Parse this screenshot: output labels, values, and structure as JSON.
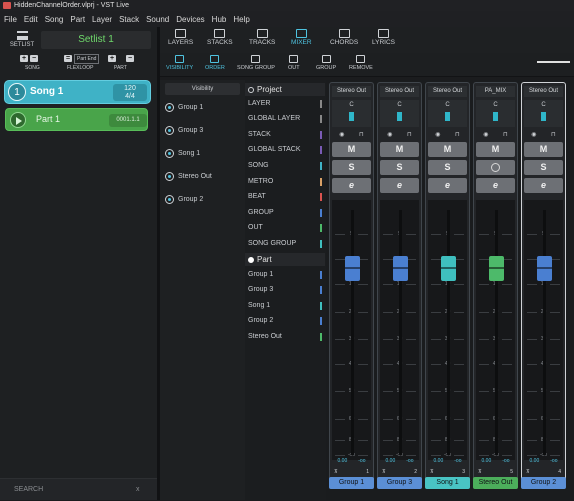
{
  "titlebar": {
    "title": "HiddenChannelOrder.vlprj - VST Live"
  },
  "menu": [
    "File",
    "Edit",
    "Song",
    "Part",
    "Layer",
    "Stack",
    "Sound",
    "Devices",
    "Hub",
    "Help"
  ],
  "setlist": {
    "button_label": "SETLIST",
    "name": "Setlist 1"
  },
  "controls": {
    "song_label": "SONG",
    "flexloop_label": "FLEXLOOP",
    "part_label": "PART",
    "part_end_label": "Part End"
  },
  "song": {
    "number": "1",
    "name": "Song 1",
    "tempo": "120",
    "signature": "4/4"
  },
  "part": {
    "name": "Part  1",
    "position": "0001.1.1"
  },
  "search": {
    "placeholder": "SEARCH",
    "clear": "x"
  },
  "topnav": [
    {
      "label": "LAYERS"
    },
    {
      "label": "STACKS"
    },
    {
      "label": "TRACKS"
    },
    {
      "label": "MIXER"
    },
    {
      "label": "CHORDS"
    },
    {
      "label": "LYRICS"
    }
  ],
  "subnav": [
    {
      "label": "VISIBILITY"
    },
    {
      "label": "ORDER"
    },
    {
      "label": "SONG GROUP"
    },
    {
      "label": "OUT"
    },
    {
      "label": "GROUP"
    },
    {
      "label": "REMOVE"
    }
  ],
  "visibility": {
    "header": "Visibility",
    "items": [
      "Group 1",
      "Group 3",
      "Song 1",
      "Stereo Out",
      "Group 2"
    ]
  },
  "list": {
    "project_header": "Project",
    "project_items": [
      "LAYER",
      "GLOBAL LAYER",
      "STACK",
      "GLOBAL STACK",
      "SONG",
      "METRO",
      "BEAT",
      "GROUP",
      "OUT",
      "SONG GROUP"
    ],
    "part_header": "Part",
    "part_items": [
      "Group 1",
      "Group 3",
      "Song 1",
      "Group 2",
      "Stereo Out"
    ]
  },
  "colors": {
    "accent": "#4fc3e0",
    "song": "#3fb2c6",
    "part": "#49a44a",
    "project_item_bar": "#4a6fa5"
  },
  "strips": [
    {
      "out": "Stereo Out",
      "name": "Group 1",
      "num": "1",
      "color": "#4a7fd1",
      "name_bg": "#5b8fd6",
      "meter": "#2fb6c9",
      "mute": "M",
      "solo": "S",
      "edit": "e",
      "left_val": "0.00",
      "right_val": "-oo"
    },
    {
      "out": "Stereo Out",
      "name": "Group 3",
      "num": "2",
      "color": "#4a7fd1",
      "name_bg": "#5b8fd6",
      "meter": "#2fb6c9",
      "mute": "M",
      "solo": "S",
      "edit": "e",
      "left_val": "0.00",
      "right_val": "-oo"
    },
    {
      "out": "Stereo Out",
      "name": "Song 1",
      "num": "3",
      "color": "#3fbfbf",
      "name_bg": "#49c4c4",
      "meter": "#2fb6c9",
      "mute": "M",
      "solo": "S",
      "edit": "e",
      "left_val": "0.00",
      "right_val": "-oo"
    },
    {
      "out": "PA_MIX",
      "name": "Stereo Out",
      "num": "5",
      "color": "#4dba6a",
      "name_bg": "#4cae5b",
      "meter": "#2fb6c9",
      "mute": "M",
      "solo": "",
      "edit": "e",
      "left_val": "0.00",
      "right_val": "-oo"
    },
    {
      "out": "Stereo Out",
      "name": "Group 2",
      "num": "4",
      "color": "#4a7fd1",
      "name_bg": "#5b8fd6",
      "meter": "#2fb6c9",
      "mute": "M",
      "solo": "S",
      "edit": "e",
      "left_val": "0.00",
      "right_val": "-oo"
    }
  ],
  "pan_label": "C",
  "fader_ticks": [
    "5",
    "0",
    "10",
    "20",
    "30",
    "40",
    "50",
    "60",
    "80",
    "-oo"
  ]
}
